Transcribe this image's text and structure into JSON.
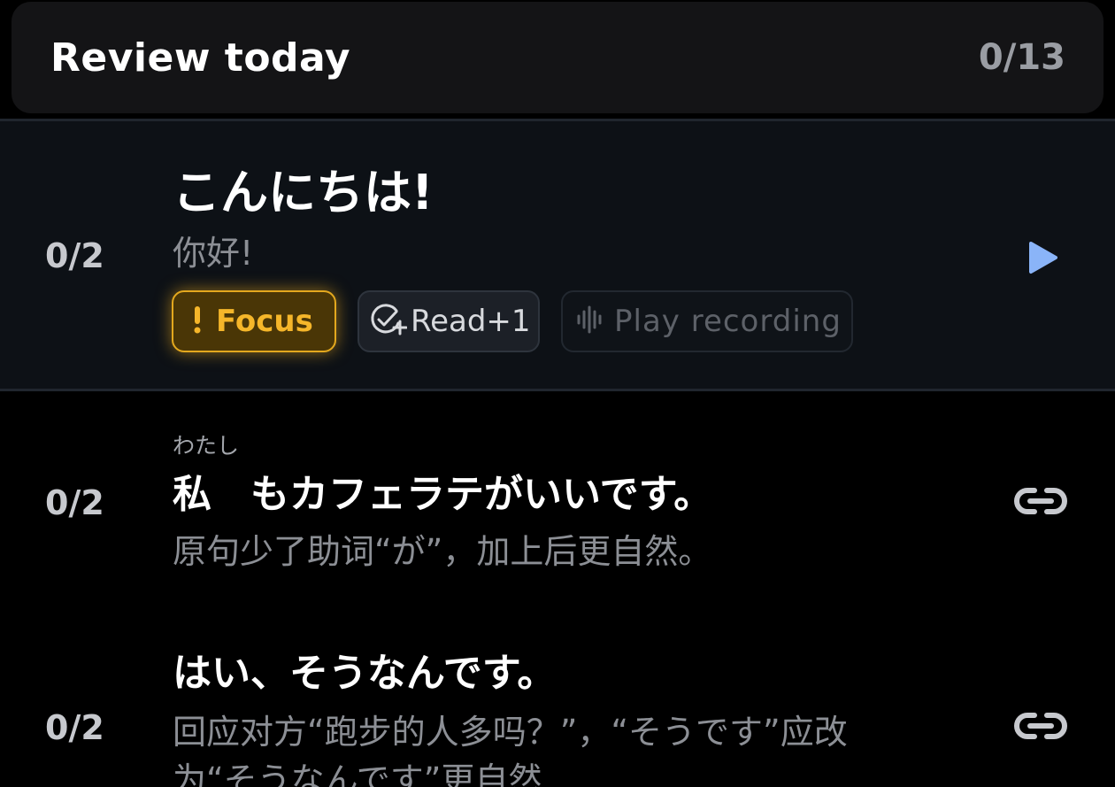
{
  "header": {
    "title": "Review today",
    "count": "0/13"
  },
  "sentences": [
    {
      "count": "0/2",
      "japanese": "こんにちは!",
      "translation": "你好!",
      "actions": {
        "focus_label": "Focus",
        "read_label": "Read+1",
        "recording_label": "Play recording"
      }
    },
    {
      "count": "0/2",
      "ruby": "わたし",
      "japanese": "私　もカフェラテがいいです。",
      "translation": "原句少了助词“が”，加上后更自然。"
    },
    {
      "count": "0/2",
      "japanese": "はい、そうなんです。",
      "translation_line1": "回应对方“跑步的人多吗？”，“そうです”应改",
      "translation_line2": "为“そうなんです”更自然"
    }
  ],
  "icons": {
    "play": "play-icon",
    "link": "link-icon",
    "focus": "exclamation-icon",
    "read": "check-plus-icon",
    "recording": "waveform-icon"
  },
  "colors": {
    "accent_blue": "#8ab4f8",
    "focus_yellow": "#f5b62a",
    "background": "#000000",
    "active_row": "#0d1116"
  }
}
